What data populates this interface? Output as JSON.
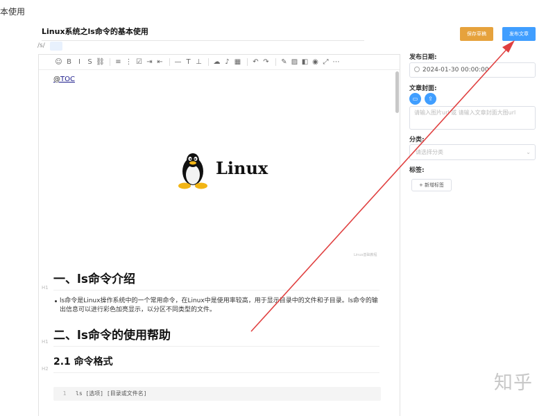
{
  "topbar": {
    "crumb": "本使用"
  },
  "article": {
    "title": "Linux系统之ls命令的基本使用",
    "slug_prefix": "/s/"
  },
  "toolbar": {
    "tools": [
      {
        "icon": "emoji-icon",
        "glyph": "☺"
      },
      {
        "icon": "bold-icon",
        "glyph": "B"
      },
      {
        "icon": "italic-icon",
        "glyph": "I"
      },
      {
        "icon": "strikethrough-icon",
        "glyph": "S"
      },
      {
        "icon": "link-icon",
        "glyph": "⛓"
      },
      {
        "icon": "bullet-list-icon",
        "glyph": "≡"
      },
      {
        "icon": "ordered-list-icon",
        "glyph": "⋮"
      },
      {
        "icon": "checklist-icon",
        "glyph": "☑"
      },
      {
        "icon": "indent-icon",
        "glyph": "⇥"
      },
      {
        "icon": "outdent-icon",
        "glyph": "⇤"
      },
      {
        "icon": "horizontal-rule-icon",
        "glyph": "—"
      },
      {
        "icon": "title-icon",
        "glyph": "T"
      },
      {
        "icon": "align-bottom-icon",
        "glyph": "⊥"
      },
      {
        "icon": "upload-icon",
        "glyph": "☁"
      },
      {
        "icon": "microphone-icon",
        "glyph": "♪"
      },
      {
        "icon": "table-icon",
        "glyph": "▦"
      },
      {
        "icon": "undo-icon",
        "glyph": "↶"
      },
      {
        "icon": "redo-icon",
        "glyph": "↷"
      },
      {
        "icon": "edit-icon",
        "glyph": "✎"
      },
      {
        "icon": "image-icon",
        "glyph": "▨"
      },
      {
        "icon": "fill-icon",
        "glyph": "◧"
      },
      {
        "icon": "eye-icon",
        "glyph": "◉"
      },
      {
        "icon": "fullscreen-icon",
        "glyph": "⤢"
      },
      {
        "icon": "more-icon",
        "glyph": "⋯"
      }
    ]
  },
  "content": {
    "toc_at": "@",
    "toc": "TOC",
    "logo_text": "Linux",
    "image_caption": "Linux基础教程",
    "h1_1": "一、ls命令介绍",
    "bullet_1": "ls命令是Linux操作系统中的一个常用命令，在Linux中是使用率较高，用于显示目录中的文件和子目录。ls命令的输出信息可以进行彩色加亮显示，以分区不同类型的文件。",
    "h1_2": "二、ls命令的使用帮助",
    "h2_1": "2.1 命令格式",
    "gutter_mark": "H1",
    "gutter_mark_2": "H2",
    "code_line_number": "1",
    "code_line": "ls [选项] [目录或文件名]"
  },
  "sidebar": {
    "draft_button": "保存草稿",
    "publish_button": "发布文章",
    "date_label": "发布日期:",
    "date_value": "2024-01-30 00:00:00",
    "cover_label": "文章封面:",
    "cover_placeholder": "请输入图片url 或 请输入文章封面大图url",
    "category_label": "分类:",
    "category_placeholder": "请选择分类",
    "tags_label": "标签:",
    "add_tag_button": "+ 新增标签"
  },
  "watermark": "知乎",
  "colors": {
    "draft": "#e6a23c",
    "primary": "#409eff",
    "arrow": "#e04040"
  }
}
